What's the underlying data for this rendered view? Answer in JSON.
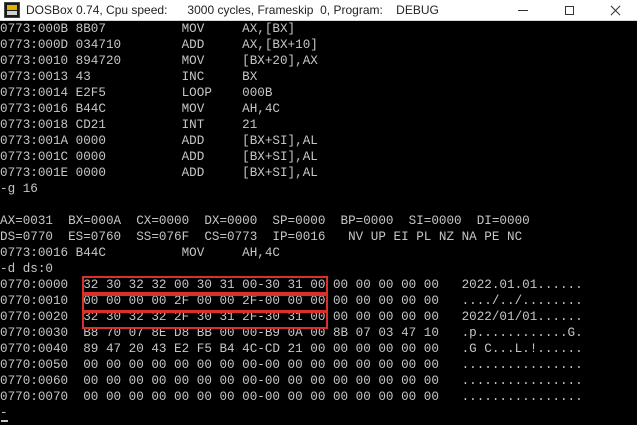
{
  "window": {
    "title": "DOSBox 0.74, Cpu speed:      3000 cycles, Frameskip  0, Program:    DEBUG",
    "icon": "dosbox-icon",
    "controls": [
      "minimize-icon",
      "maximize-icon",
      "close-icon"
    ]
  },
  "terminal": {
    "lines": [
      "0773:000B 8B07          MOV     AX,[BX]",
      "0773:000D 034710        ADD     AX,[BX+10]",
      "0773:0010 894720        MOV     [BX+20],AX",
      "0773:0013 43            INC     BX",
      "0773:0014 E2F5          LOOP    000B",
      "0773:0016 B44C          MOV     AH,4C",
      "0773:0018 CD21          INT     21",
      "0773:001A 0000          ADD     [BX+SI],AL",
      "0773:001C 0000          ADD     [BX+SI],AL",
      "0773:001E 0000          ADD     [BX+SI],AL",
      "-g 16",
      "",
      "AX=0031  BX=000A  CX=0000  DX=0000  SP=0000  BP=0000  SI=0000  DI=0000",
      "DS=0770  ES=0760  SS=076F  CS=0773  IP=0016   NV UP EI PL NZ NA PE NC",
      "0773:0016 B44C          MOV     AH,4C",
      "-d ds:0",
      "0770:0000  32 30 32 32 00 30 31 00-30 31 00 00 00 00 00 00   2022.01.01......",
      "0770:0010  00 00 00 00 2F 00 00 2F-00 00 00 00 00 00 00 00   ..../../........",
      "0770:0020  32 30 32 32 2F 30 31 2F-30 31 00 00 00 00 00 00   2022/01/01......",
      "0770:0030  B8 70 07 8E D8 BB 00 00-B9 0A 00 8B 07 03 47 10   .p............G.",
      "0770:0040  89 47 20 43 E2 F5 B4 4C-CD 21 00 00 00 00 00 00   .G C...L.!......",
      "0770:0050  00 00 00 00 00 00 00 00-00 00 00 00 00 00 00 00   ................",
      "0770:0060  00 00 00 00 00 00 00 00-00 00 00 00 00 00 00 00   ................",
      "0770:0070  00 00 00 00 00 00 00 00-00 00 00 00 00 00 00 00   ................",
      "-"
    ],
    "colors": {
      "text": "#c6c6c6",
      "background": "#000000",
      "highlight": "#d9302b"
    },
    "highlighted_rows": [
      "0770:0000",
      "0770:0010",
      "0770:0020"
    ]
  }
}
